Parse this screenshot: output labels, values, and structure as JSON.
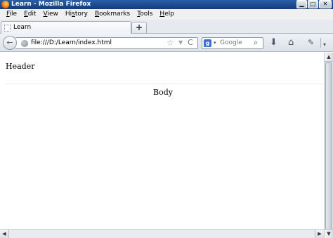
{
  "window": {
    "title": "Learn - Mozilla Firefox",
    "minimize_glyph": "▁",
    "maximize_glyph": "□",
    "close_glyph": "✕"
  },
  "menu": {
    "items": [
      {
        "accel": "F",
        "rest": "ile"
      },
      {
        "accel": "E",
        "rest": "dit"
      },
      {
        "accel": "V",
        "rest": "iew"
      },
      {
        "accel": "",
        "pre": "Hi",
        "accel2": "s",
        "rest": "tory"
      },
      {
        "accel": "B",
        "rest": "ookmarks"
      },
      {
        "accel": "T",
        "rest": "ools"
      },
      {
        "accel": "H",
        "rest": "elp"
      }
    ]
  },
  "tabs": {
    "active_label": "Learn",
    "new_tab_glyph": "+"
  },
  "navbar": {
    "back_glyph": "←",
    "url": "file:///D:/Learn/index.html",
    "bookmark_star_glyph": "☆",
    "dropdown_glyph": "▼",
    "reload_glyph": "C",
    "search_engine_letter": "g",
    "search_dropdown_glyph": "▾",
    "search_placeholder": "Google",
    "search_glyph": "⌕",
    "download_glyph": "⬇",
    "home_glyph": "⌂",
    "addon_glyph": "✎",
    "menu_dropdown_glyph": "▾"
  },
  "page": {
    "header": "Header",
    "body": "Body"
  },
  "scrollbars": {
    "up_glyph": "▲",
    "down_glyph": "▼",
    "left_glyph": "◀",
    "right_glyph": "▶"
  },
  "icons": {
    "app": "firefox-logo",
    "tab": "blank-page-icon",
    "site": "globe-icon",
    "search_engine": "google-icon"
  },
  "colors": {
    "titlebar": "#1b4a8e",
    "menubar": "#f0f0f0",
    "content_bg": "#ffffff"
  }
}
